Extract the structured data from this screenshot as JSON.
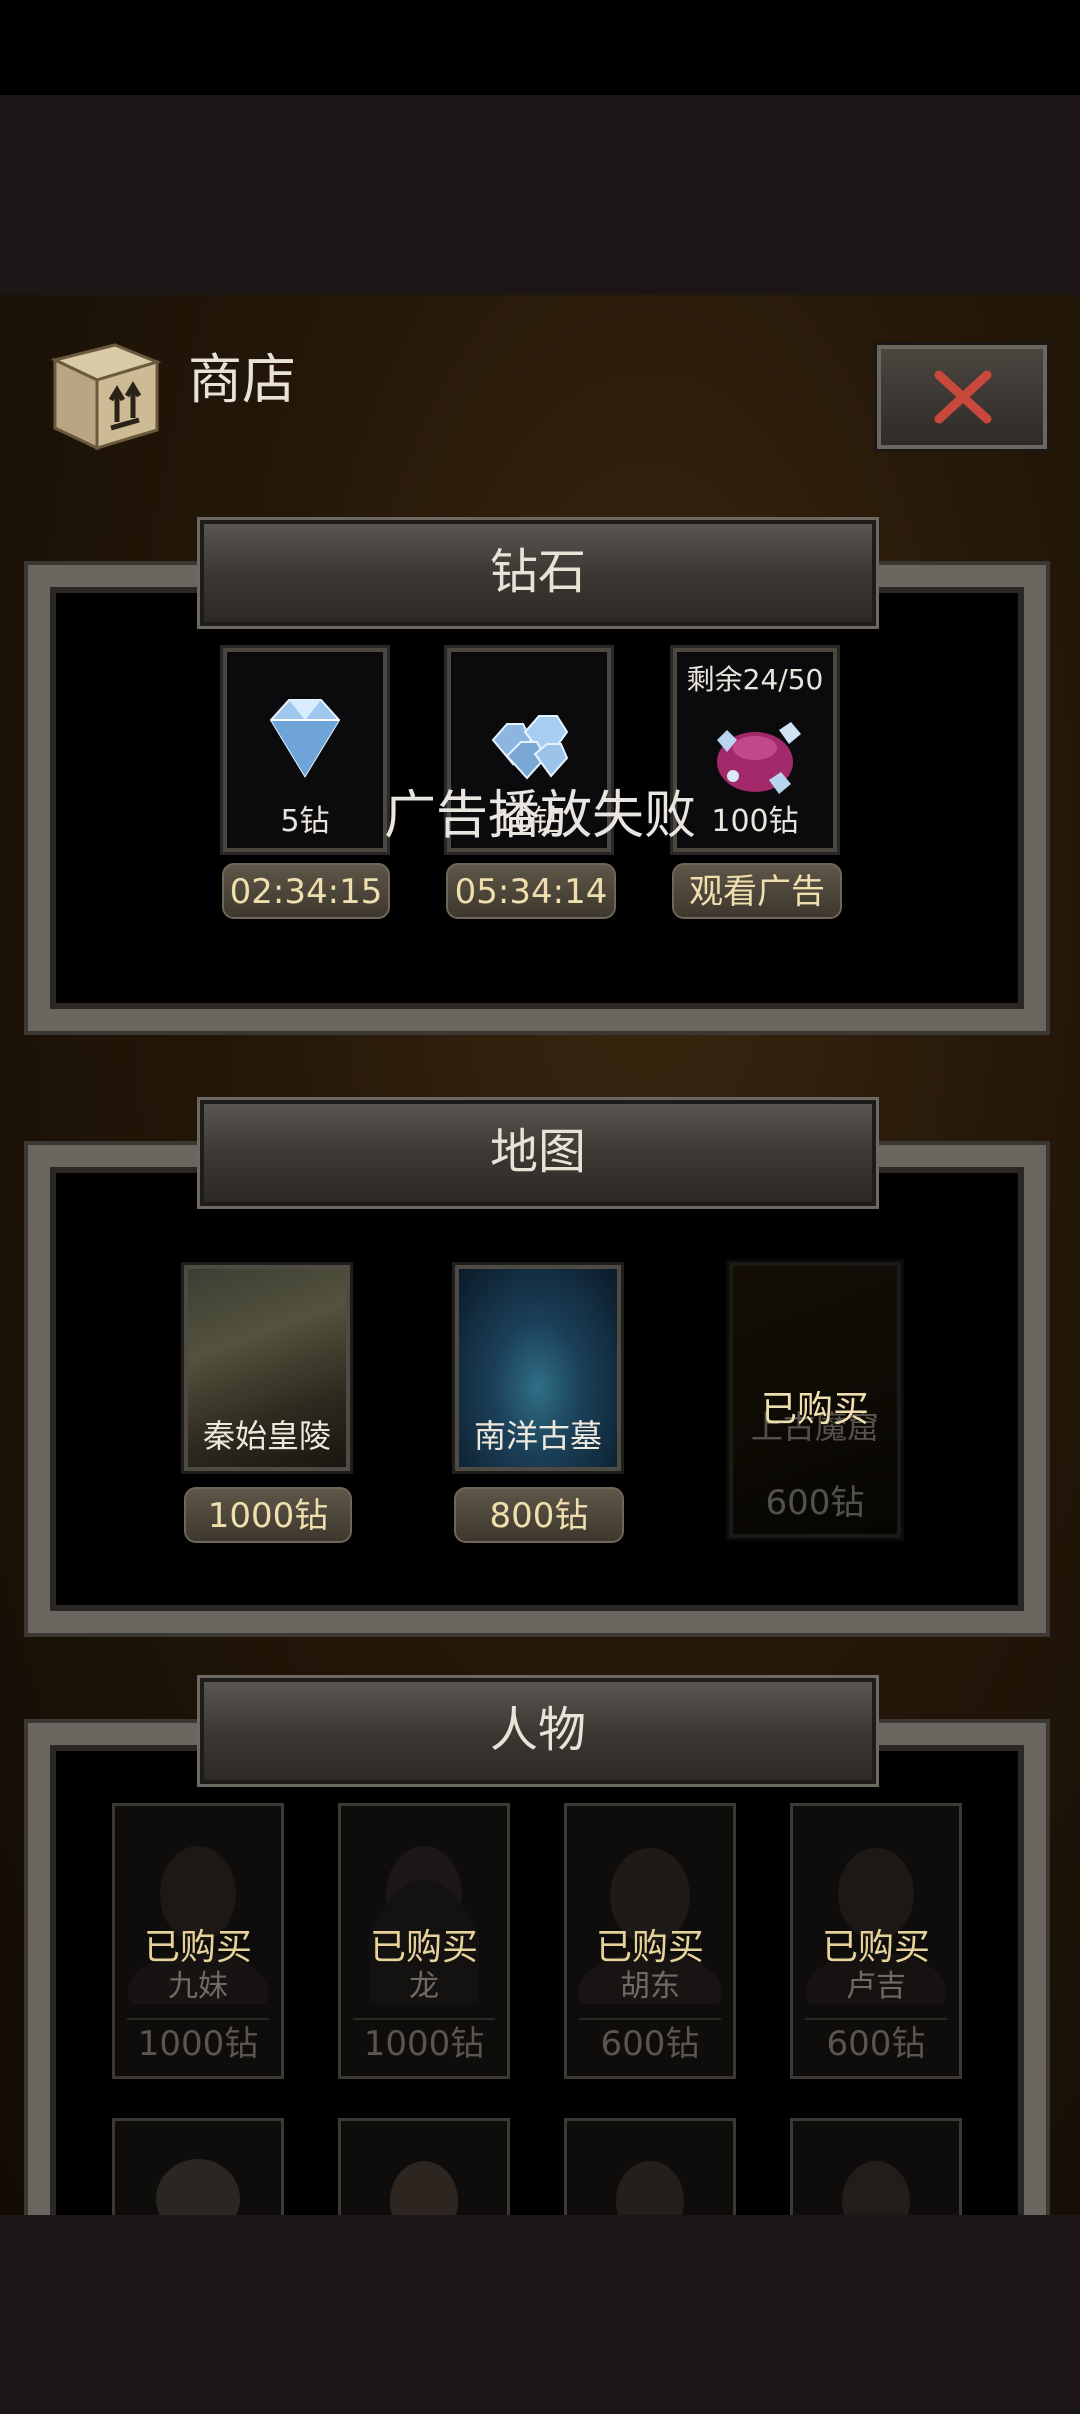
{
  "shop": {
    "title": "商店"
  },
  "diamonds": {
    "header": "钻石",
    "items": [
      {
        "label": "5钻",
        "button": "02:34:15",
        "icon": "diamond-icon"
      },
      {
        "label": "10钻",
        "button": "05:34:14",
        "icon": "diamond-pile-icon"
      },
      {
        "label": "100钻",
        "button": "观看广告",
        "top_label": "剩余24/50",
        "icon": "gem-bag-icon"
      }
    ]
  },
  "toast": "广告播放失败",
  "maps": {
    "header": "地图",
    "items": [
      {
        "name": "秦始皇陵",
        "price": "1000钻"
      },
      {
        "name": "南洋古墓",
        "price": "800钻"
      },
      {
        "name": "上古魔窟",
        "price": "600钻",
        "status": "已购买"
      }
    ]
  },
  "characters": {
    "header": "人物",
    "items": [
      {
        "name": "九妹",
        "price": "1000钻",
        "status": "已购买"
      },
      {
        "name": "龙",
        "price": "1000钻",
        "status": "已购买"
      },
      {
        "name": "胡东",
        "price": "600钻",
        "status": "已购买"
      },
      {
        "name": "卢吉",
        "price": "600钻",
        "status": "已购买"
      }
    ]
  },
  "colors": {
    "accent_gold": "#f0dfae",
    "close_x": "#c8493b"
  }
}
